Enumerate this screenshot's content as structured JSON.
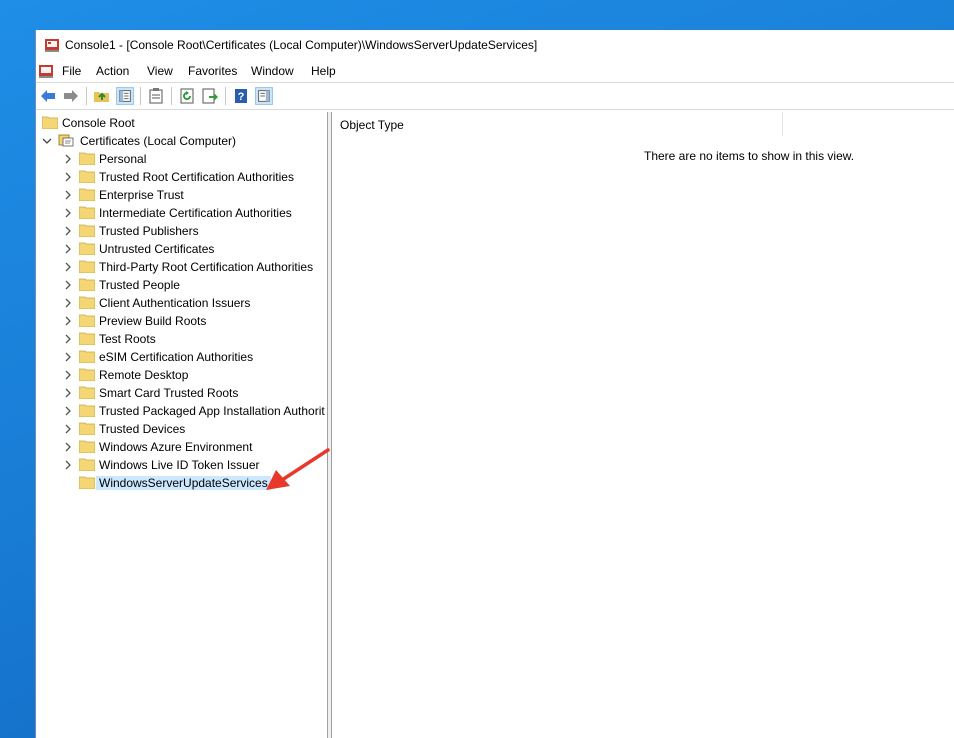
{
  "window": {
    "title": "Console1 - [Console Root\\Certificates (Local Computer)\\WindowsServerUpdateServices]"
  },
  "menu": [
    "File",
    "Action",
    "View",
    "Favorites",
    "Window",
    "Help"
  ],
  "toolbar": {
    "icons": [
      "back-arrow-icon",
      "forward-arrow-icon",
      "up-folder-icon",
      "show-hide-tree-icon",
      "properties-icon",
      "refresh-icon",
      "export-list-icon",
      "help-icon",
      "show-hide-action-pane-icon"
    ]
  },
  "tree": {
    "root": "Console Root",
    "store": "Certificates (Local Computer)",
    "items": [
      "Personal",
      "Trusted Root Certification Authorities",
      "Enterprise Trust",
      "Intermediate Certification Authorities",
      "Trusted Publishers",
      "Untrusted Certificates",
      "Third-Party Root Certification Authorities",
      "Trusted People",
      "Client Authentication Issuers",
      "Preview Build Roots",
      "Test Roots",
      "eSIM Certification Authorities",
      "Remote Desktop",
      "Smart Card Trusted Roots",
      "Trusted Packaged App Installation Authorit",
      "Trusted Devices",
      "Windows Azure Environment",
      "Windows Live ID Token Issuer"
    ],
    "selected": "WindowsServerUpdateServices"
  },
  "list": {
    "column": "Object Type",
    "empty_message": "There are no items to show in this view."
  },
  "colors": {
    "desktop": "#1a7fd8",
    "selection": "#cce8ff",
    "folder": "#f5d675",
    "arrow": "#e8382a"
  }
}
